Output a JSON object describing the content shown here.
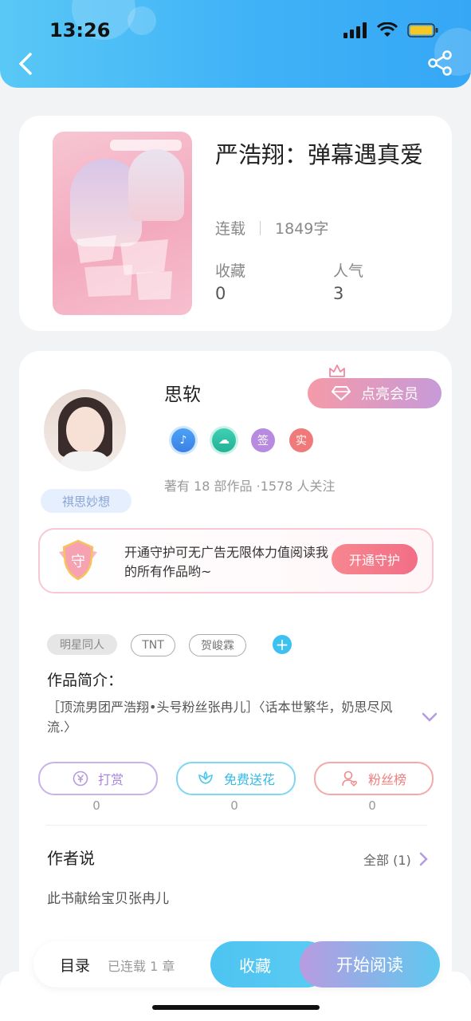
{
  "status_bar": {
    "time": "13:26"
  },
  "book": {
    "title": "严浩翔：弹幕遇真爱",
    "status": "连载",
    "word_count": "1849字",
    "favorites_label": "收藏",
    "favorites_value": "0",
    "popularity_label": "人气",
    "popularity_value": "3"
  },
  "author": {
    "name": "思软",
    "pennant": "祺思妙想",
    "vip_button": "点亮会员",
    "badges": [
      "♪",
      "☁",
      "签",
      "实"
    ],
    "stats": "著有 18 部作品 ·1578 人关注"
  },
  "guard": {
    "text": "开通守护可无广告无限体力值阅读我的所有作品哟~",
    "button": "开通守护",
    "shield_char": "守"
  },
  "tags": [
    "明星同人",
    "TNT",
    "贺峻霖"
  ],
  "intro": {
    "label": "作品简介：",
    "text": "［顶流男团严浩翔•头号粉丝张冉儿］〈话本世繁华，奶思尽风流.〉"
  },
  "actions": [
    {
      "label": "打赏",
      "count": "0",
      "color": "#b69ae0"
    },
    {
      "label": "免费送花",
      "count": "0",
      "color": "#4cc7ee"
    },
    {
      "label": "粉丝榜",
      "count": "0",
      "color": "#f08a8a"
    }
  ],
  "author_says": {
    "title": "作者说",
    "all_link": "全部 (1)",
    "content": "此书献给宝贝张冉儿"
  },
  "bottom_bar": {
    "toc_label": "目录",
    "toc_count": "已连载 1 章",
    "favorite_button": "收藏",
    "read_button": "开始阅读"
  }
}
